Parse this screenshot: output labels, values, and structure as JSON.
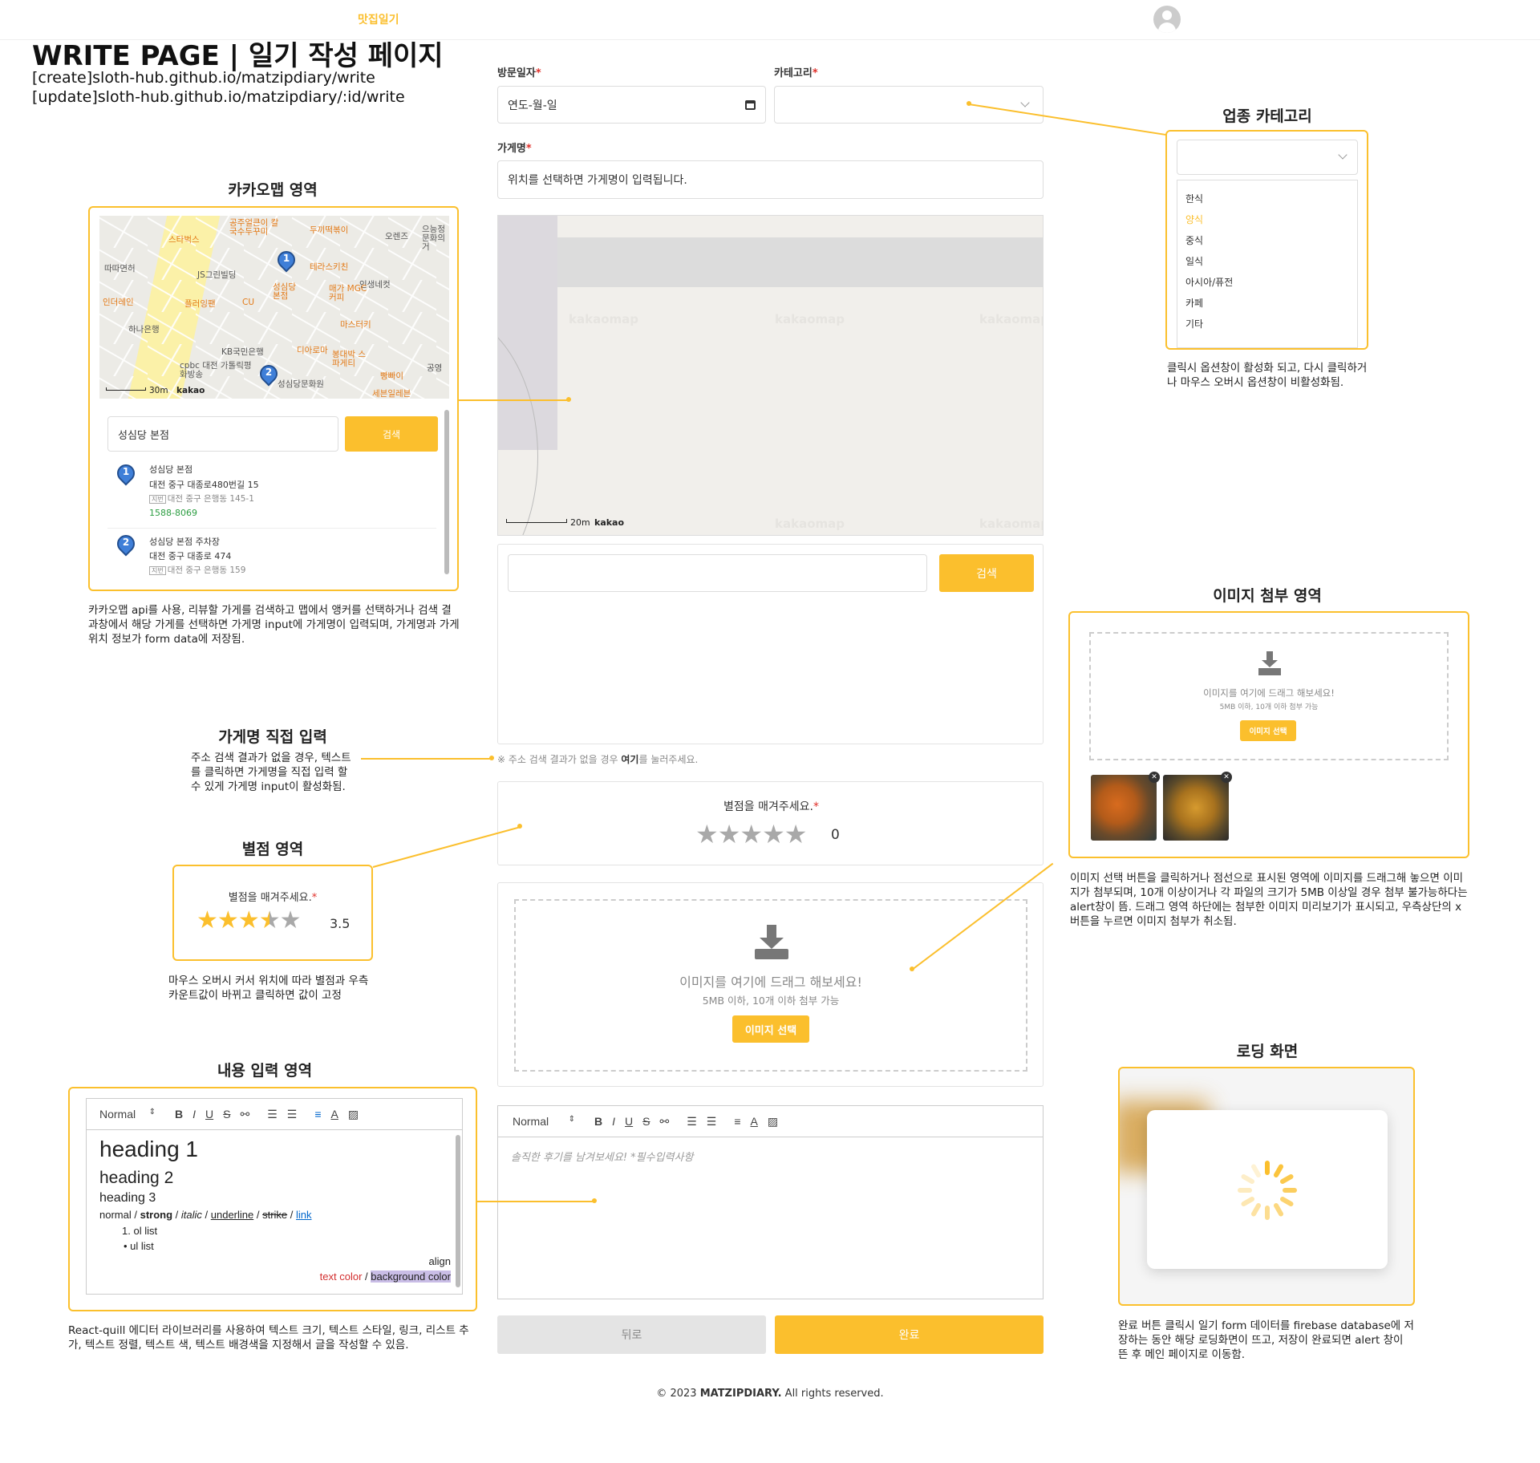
{
  "header": {
    "logo": "맛집일기"
  },
  "page": {
    "title": "WRITE PAGE | 일기 작성 페이지",
    "url_create": "[create]sloth-hub.github.io/matzipdiary/write",
    "url_update": "[update]sloth-hub.github.io/matzipdiary/:id/write"
  },
  "form": {
    "visit_date_label": "방문일자",
    "visit_date_placeholder": "연도-월-일",
    "category_label": "카테고리",
    "store_name_label": "가게명",
    "store_name_placeholder": "위치를 선택하면 가게명이 입력됩니다.",
    "map_scale": "20m",
    "map_brand": "kakao",
    "map_watermark": "kakaomap",
    "search_button": "검색",
    "direct_note_prefix": "※ 주소 검색 결과가 없을 경우 ",
    "direct_note_link": "여기",
    "direct_note_suffix": "를 눌러주세요.",
    "rating_label": "별점을 매겨주세요.",
    "rating_value": "0",
    "upload_text": "이미지를 여기에 드래그 해보세요!",
    "upload_sub": "5MB 이하, 10개 이하 첨부 가능",
    "upload_button": "이미지 선택",
    "editor_header_select": "Normal",
    "editor_placeholder": "솔직한 후기를 남겨보세요! *필수입력사항",
    "back_button": "뒤로",
    "submit_button": "완료"
  },
  "footer": {
    "copyright_prefix": "© 2023 ",
    "brand": "MATZIPDIARY.",
    "copyright_suffix": " All rights reserved."
  },
  "annotations": {
    "kakao": {
      "title": "카카오맵 영역",
      "search_value": "성심당 본점",
      "search_button": "검색",
      "results": [
        {
          "num": "1",
          "name": "성심당 본점",
          "addr": "대전 중구 대종로480번길 15",
          "jibun_tag": "지번",
          "jibun": "대전 중구 은행동 145-1",
          "phone": "1588-8069"
        },
        {
          "num": "2",
          "name": "성심당 본점 주차장",
          "addr": "대전 중구 대종로 474",
          "jibun_tag": "지번",
          "jibun": "대전 중구 은행동 159",
          "phone": ""
        }
      ],
      "map_labels": [
        "스타벅스",
        "공주얼큰이 칼국수두꾸미",
        "두끼떡볶이",
        "오렌즈",
        "으능정 문화의거",
        "따따면허",
        "JS그린빌딩",
        "테라스키친",
        "인생네컷",
        "인더레인",
        "플러잉팬",
        "CU",
        "성심당 본점",
        "매가 MGC커피",
        "마스터키",
        "하나은행",
        "KB국민은행",
        "디아로마",
        "봉대박 스파게티",
        "cpbc 대전 가톨릭평화방송",
        "성심당문화원",
        "빵빠이",
        "세븐일레븐",
        "공영"
      ],
      "scale": "30m",
      "brand": "kakao",
      "desc": "카카오맵 api를 사용, 리뷰할 가게를 검색하고 맵에서 앵커를 선택하거나 검색 결과창에서 해당 가게를 선택하면 가게명 input에 가게명이 입력되며, 가게명과 가게 위치 정보가 form data에 저장됨."
    },
    "direct": {
      "title": "가게명 직접 입력",
      "desc": "주소 검색 결과가 없을 경우, 텍스트를 클릭하면 가게명을 직접 입력 할 수 있게 가게명 input이 활성화됨."
    },
    "rating": {
      "title": "별점 영역",
      "label": "별점을 매겨주세요.",
      "value": "3.5",
      "stars": 3.5,
      "desc": "마우스 오버시 커서 위치에 따라 별점과 우측 카운트값이 바뀌고 클릭하면 값이 고정"
    },
    "editor": {
      "title": "내용 입력 영역",
      "select": "Normal",
      "h1": "heading 1",
      "h2": "heading 2",
      "h3": "heading 3",
      "normal": "normal",
      "strong": "strong",
      "italic": "italic",
      "underline": "underline",
      "strike": "strike",
      "link": "link",
      "ol": "ol list",
      "ul": "ul list",
      "align": "align",
      "text_color": "text color",
      "bg_color": "background color",
      "desc": "React-quill 에디터 라이브러리를 사용하여 텍스트 크기, 텍스트 스타일, 링크, 리스트 추가, 텍스트 정렬, 텍스트 색, 텍스트 배경색을 지정해서 글을 작성할 수 있음."
    },
    "category": {
      "title": "업종 카테고리",
      "options": [
        "한식",
        "양식",
        "중식",
        "일식",
        "아시아/퓨전",
        "카페",
        "기타"
      ],
      "selected_index": 1,
      "desc": "클릭시 옵션창이 활성화 되고, 다시 클릭하거나 마우스 오버시 옵션창이 비활성화됨."
    },
    "image": {
      "title": "이미지 첨부 영역",
      "upload_text": "이미지를 여기에 드래그 해보세요!",
      "upload_sub": "5MB 이하, 10개 이하 첨부 가능",
      "upload_button": "이미지 선택",
      "desc": "이미지 선택 버튼을 클릭하거나 점선으로 표시된 영역에 이미지를 드래그해 놓으면 이미지가 첨부되며, 10개 이상이거나 각 파일의 크기가 5MB 이상일 경우 첨부 불가능하다는 alert창이 뜸. 드래그 영역 하단에는 첨부한 이미지 미리보기가 표시되고, 우측상단의 x버튼을 누르면 이미지 첨부가 취소됨."
    },
    "loading": {
      "title": "로딩 화면",
      "desc": "완료 버튼 클릭시 일기 form 데이터를 firebase database에 저장하는 동안 해당 로딩화면이 뜨고, 저장이 완료되면 alert 창이 뜬 후 메인 페이지로 이동함."
    }
  },
  "colors": {
    "accent": "#fbbf2d",
    "required": "#e0302a"
  }
}
